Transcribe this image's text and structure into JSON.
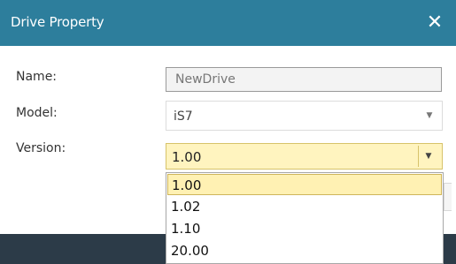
{
  "window": {
    "title": "Drive Property",
    "close_icon": "close-icon",
    "close_glyph": "✕"
  },
  "form": {
    "name_label": "Name:",
    "name_value": "NewDrive",
    "model_label": "Model:",
    "model_value": "iS7",
    "version_label": "Version:",
    "version_value": "1.00",
    "dropdown_icon": "chevron-down-icon",
    "dropdown_glyph": "▼"
  },
  "version_options": [
    "1.00",
    "1.02",
    "1.10",
    "20.00"
  ],
  "colors": {
    "title_bar": "#2d7e9c",
    "selected_background": "#fff1b3",
    "bottom_bar": "#2c3b48"
  }
}
